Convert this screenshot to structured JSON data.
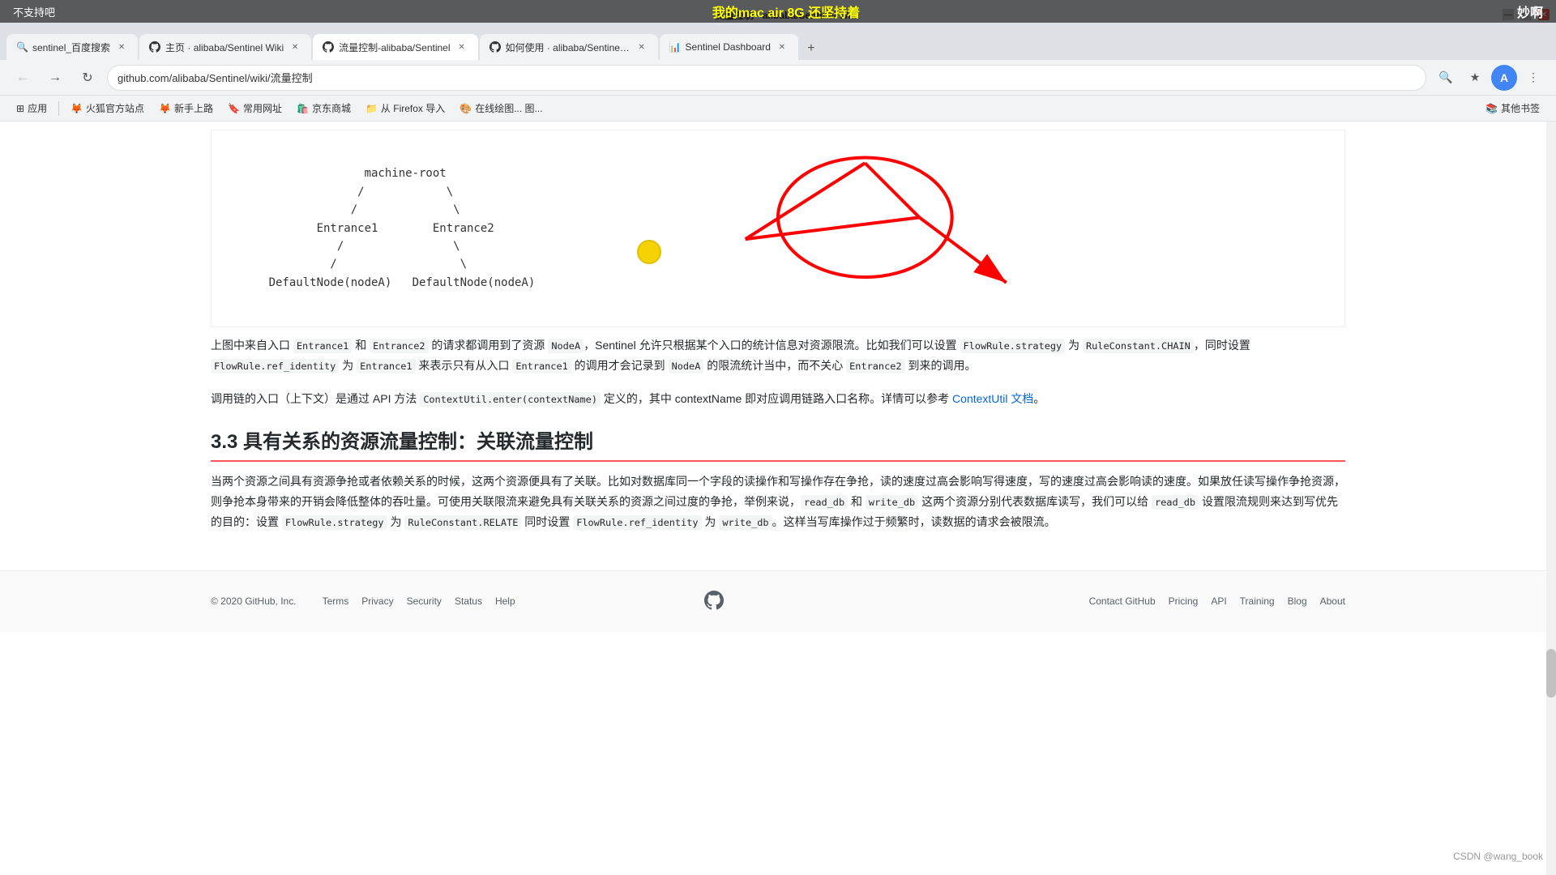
{
  "top_annotation": {
    "left": "不支持吧",
    "center": "我的mac air 8G 还坚持着",
    "right": "妙啊"
  },
  "browser": {
    "tabs": [
      {
        "id": "tab1",
        "favicon": "🔍",
        "title": "sentinel_百度搜索",
        "active": false
      },
      {
        "id": "tab2",
        "favicon": "🐙",
        "title": "主页 · alibaba/Sentinel Wiki",
        "active": false
      },
      {
        "id": "tab3",
        "favicon": "🐙",
        "title": "流量控制-alibaba/Sentinel",
        "active": true
      },
      {
        "id": "tab4",
        "favicon": "🐙",
        "title": "如何使用 · alibaba/Sentinel W",
        "active": false
      },
      {
        "id": "tab5",
        "favicon": "📊",
        "title": "Sentinel Dashboard",
        "active": false
      }
    ],
    "url": "github.com/alibaba/Sentinel/wiki/流量控制",
    "bookmarks": [
      {
        "label": "应用",
        "icon": "⊞"
      },
      {
        "label": "火狐官方站点",
        "icon": "🦊"
      },
      {
        "label": "新手上路",
        "icon": "🦊"
      },
      {
        "label": "常用网址",
        "icon": "🔖"
      },
      {
        "label": "京东商城",
        "icon": "🛍️"
      },
      {
        "label": "从 Firefox 导入",
        "icon": "📁"
      },
      {
        "label": "在线绘图... 图...",
        "icon": "🎨"
      },
      {
        "label": "其他书签",
        "icon": "📚"
      }
    ]
  },
  "diagram": {
    "content": "                    machine-root\n                   /            \\\n                  /              \\\n             Entrance1        Entrance2\n                /                \\\n               /                  \\\n      DefaultNode(nodeA)   DefaultNode(nodeA)"
  },
  "text_blocks": [
    {
      "id": "para1",
      "text": "上图中来自入口 Entrance1 和 Entrance2 的请求都调用到了资源 NodeA，Sentinel 允许只根据某个入口的统计信息对资源限流。比如我们可以设置 FlowRule.strategy 为 RuleConstant.CHAIN，同时设置 FlowRule.ref_identity 为 Entrance1 来表示只有从入口 Entrance1 的调用才会记录到 NodeA 的限流统计当中，而不关心 Entrance2 到来的调用。"
    },
    {
      "id": "para2",
      "text": "调用链的入口（上下文）是通过 API 方法 ContextUtil.enter(contextName) 定义的，其中 contextName 即对应调用链路入口名称。详情可以参考 ContextUtil 文档。"
    }
  ],
  "section": {
    "title": "3.3 具有关系的资源流量控制：关联流量控制"
  },
  "section_para": "当两个资源之间具有资源争抢或者依赖关系的时候，这两个资源便具有了关联。比如对数据库同一个字段的读操作和写操作存在争抢，读的速度过高会影响写得速度，写的速度过高会影响读的速度。如果放任读写操作争抢资源，则争抢本身带来的开销会降低整体的吞吐量。可使用关联限流来避免具有关联关系的资源之间过度的争抢，举例来说，read_db 和 write_db 这两个资源分别代表数据库读写，我们可以给 read_db 设置限流规则来达到写优先的目的：设置 FlowRule.strategy 为 RuleConstant.RELATE 同时设置 FlowRule.ref_identity 为 write_db。这样当写库操作过于频繁时，读数据的请求会被限流。",
  "inline_codes": [
    "FlowRule.strategy",
    "RuleConstant.CHAIN",
    "FlowRule.ref_identity",
    "Entrance1",
    "NodeA",
    "ContextUtil.enter(contextName)",
    "read_db",
    "write_db",
    "FlowRule.strategy",
    "RuleConstant.RELATE",
    "FlowRule.ref_identity",
    "write_db"
  ],
  "footer": {
    "copyright": "© 2020 GitHub, Inc.",
    "links": [
      "Terms",
      "Privacy",
      "Security",
      "Status",
      "Help"
    ],
    "right_links": [
      "Contact GitHub",
      "Pricing",
      "API",
      "Training",
      "Blog",
      "About"
    ]
  },
  "csdn": {
    "watermark": "CSDN @wang_book"
  }
}
